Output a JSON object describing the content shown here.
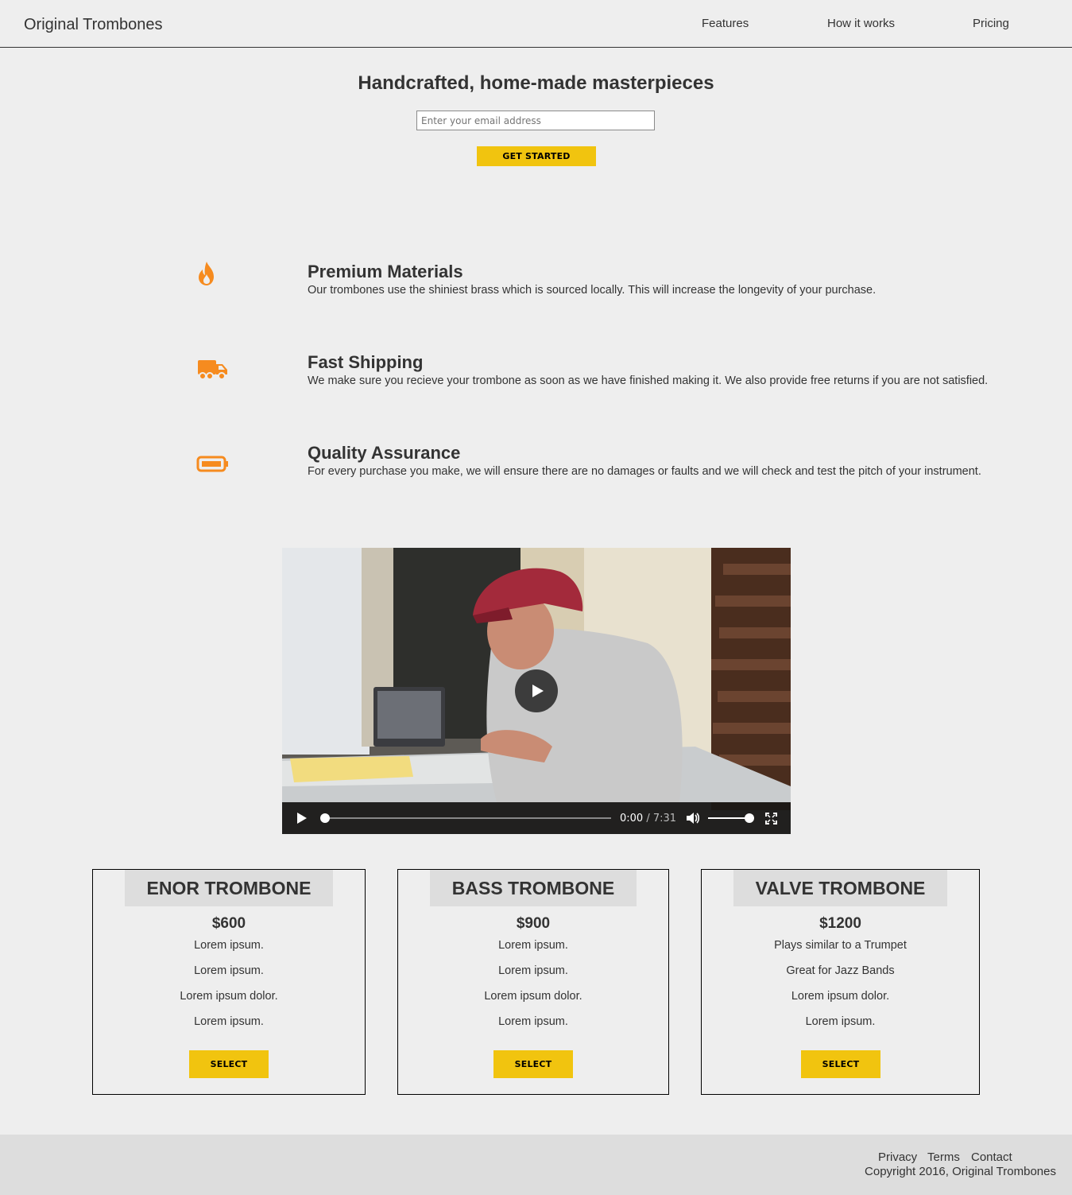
{
  "header": {
    "logo": "Original Trombones",
    "nav": [
      "Features",
      "How it works",
      "Pricing"
    ]
  },
  "hero": {
    "title": "Handcrafted, home-made masterpieces",
    "email_placeholder": "Enter your email address",
    "cta_label": "GET STARTED"
  },
  "features": [
    {
      "icon": "fire-icon",
      "title": "Premium Materials",
      "text": "Our trombones use the shiniest brass which is sourced locally. This will increase the longevity of your purchase."
    },
    {
      "icon": "truck-icon",
      "title": "Fast Shipping",
      "text": "We make sure you recieve your trombone as soon as we have finished making it. We also provide free returns if you are not satisfied."
    },
    {
      "icon": "battery-icon",
      "title": "Quality Assurance",
      "text": "For every purchase you make, we will ensure there are no damages or faults and we will check and test the pitch of your instrument."
    }
  ],
  "video": {
    "current_time": "0:00",
    "duration": "7:31",
    "progress": 0,
    "volume": 1
  },
  "pricing": [
    {
      "name": "ENOR TROMBONE",
      "price": "$600",
      "items": [
        "Lorem ipsum.",
        "Lorem ipsum.",
        "Lorem ipsum dolor.",
        "Lorem ipsum."
      ],
      "button": "SELECT"
    },
    {
      "name": "BASS TROMBONE",
      "price": "$900",
      "items": [
        "Lorem ipsum.",
        "Lorem ipsum.",
        "Lorem ipsum dolor.",
        "Lorem ipsum."
      ],
      "button": "SELECT"
    },
    {
      "name": "VALVE TROMBONE",
      "price": "$1200",
      "items": [
        "Plays similar to a Trumpet",
        "Great for Jazz Bands",
        "Lorem ipsum dolor.",
        "Lorem ipsum."
      ],
      "button": "SELECT"
    }
  ],
  "footer": {
    "links": [
      "Privacy",
      "Terms",
      "Contact"
    ],
    "copyright": "Copyright 2016, Original Trombones"
  },
  "colors": {
    "accent": "#f1c40f",
    "icon": "#f68b1f",
    "background": "#eeeeee",
    "footer_bg": "#dddddd"
  }
}
